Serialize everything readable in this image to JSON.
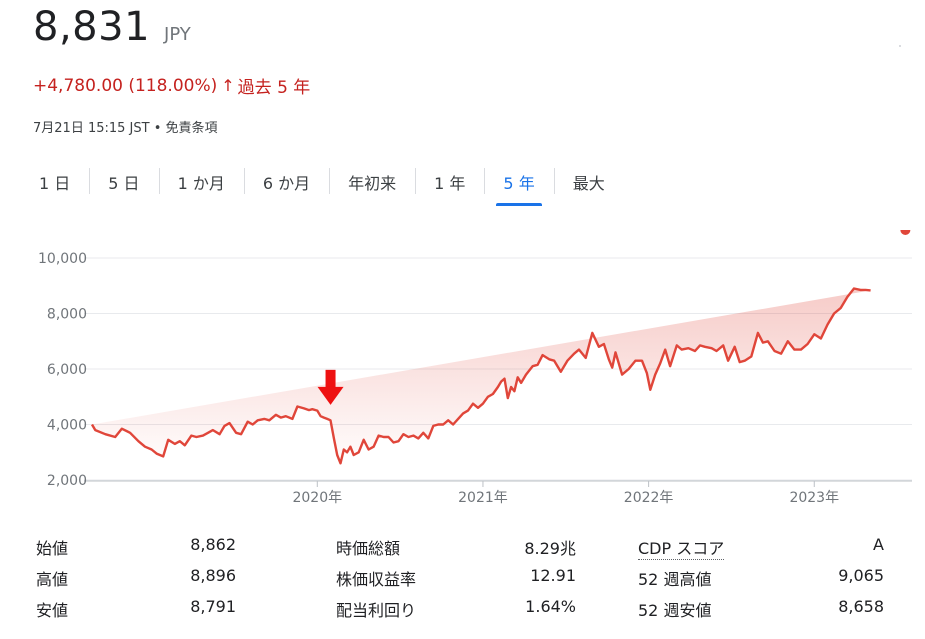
{
  "price": "8,831",
  "currency": "JPY",
  "change": "+4,780.00 (118.00%)",
  "change_arrow": "↑",
  "change_period": "過去 5 年",
  "timestamp": "7月21日 15:15 JST",
  "disclaimer": "免責条項",
  "tabs": [
    "1 日",
    "5 日",
    "1 か月",
    "6 か月",
    "年初来",
    "1 年",
    "5 年",
    "最大"
  ],
  "active_tab": "5 年",
  "colors": {
    "line": "#e0463a",
    "accent": "#1a73e8",
    "negative": "#c5221f",
    "marker": "#ee1111"
  },
  "chart_data": {
    "type": "area",
    "yticks": [
      "10,000",
      "8,000",
      "6,000",
      "4,000",
      "2,000"
    ],
    "ylim": [
      2000,
      10000
    ],
    "xticks": [
      {
        "label": "2020年",
        "t": 2020.0
      },
      {
        "label": "2021年",
        "t": 2021.0
      },
      {
        "label": "2022年",
        "t": 2022.0
      },
      {
        "label": "2023年",
        "t": 2023.0
      }
    ],
    "xlim": [
      2018.64,
      2023.59
    ],
    "annotation": {
      "type": "down-arrow",
      "t": 2020.08,
      "y": 4600
    },
    "series": [
      {
        "t": [
          2018.64,
          2018.66,
          2018.72,
          2018.78,
          2018.82,
          2018.87,
          2018.92,
          2018.96,
          2019.0,
          2019.03,
          2019.07,
          2019.1,
          2019.14,
          2019.17,
          2019.2,
          2019.24,
          2019.27,
          2019.31,
          2019.34,
          2019.37,
          2019.41,
          2019.44,
          2019.47,
          2019.51,
          2019.54,
          2019.58,
          2019.61,
          2019.64,
          2019.68,
          2019.71,
          2019.75,
          2019.78,
          2019.81,
          2019.85,
          2019.88,
          2019.92,
          2019.95,
          2019.97,
          2020.0,
          2020.02,
          2020.04,
          2020.06,
          2020.08,
          2020.1,
          2020.12,
          2020.14,
          2020.16,
          2020.18,
          2020.2,
          2020.22,
          2020.25,
          2020.28,
          2020.31,
          2020.34,
          2020.37,
          2020.4,
          2020.43,
          2020.46,
          2020.49,
          2020.52,
          2020.55,
          2020.58,
          2020.61,
          2020.64,
          2020.67,
          2020.7,
          2020.73,
          2020.76,
          2020.79,
          2020.82,
          2020.85,
          2020.88,
          2020.91,
          2020.94,
          2020.97,
          2021.0,
          2021.03,
          2021.06,
          2021.09,
          2021.11,
          2021.13,
          2021.15,
          2021.17,
          2021.19,
          2021.21,
          2021.23,
          2021.26,
          2021.3,
          2021.33,
          2021.36,
          2021.4,
          2021.43,
          2021.47,
          2021.51,
          2021.55,
          2021.58,
          2021.62,
          2021.66,
          2021.7,
          2021.73,
          2021.76,
          2021.78,
          2021.8,
          2021.84,
          2021.88,
          2021.92,
          2021.96,
          2021.99,
          2022.01,
          2022.04,
          2022.07,
          2022.1,
          2022.13,
          2022.17,
          2022.2,
          2022.24,
          2022.28,
          2022.31,
          2022.34,
          2022.38,
          2022.41,
          2022.45,
          2022.48,
          2022.52,
          2022.55,
          2022.58,
          2022.62,
          2022.66,
          2022.69,
          2022.72,
          2022.76,
          2022.8,
          2022.84,
          2022.88,
          2022.92,
          2022.96,
          2023.0,
          2023.04,
          2023.08,
          2023.12,
          2023.16,
          2023.2,
          2023.24,
          2023.28,
          2023.31,
          2023.34,
          2023.37,
          2023.4,
          2023.43,
          2023.46,
          2023.49,
          2023.52,
          2023.55
        ],
        "y": [
          4000,
          3800,
          3650,
          3550,
          3850,
          3700,
          3400,
          3200,
          3100,
          2950,
          2850,
          3450,
          3300,
          3400,
          3250,
          3600,
          3550,
          3600,
          3700,
          3800,
          3650,
          3950,
          4050,
          3700,
          3650,
          4100,
          4000,
          4150,
          4200,
          4150,
          4350,
          4250,
          4300,
          4200,
          4650,
          4580,
          4520,
          4550,
          4500,
          4300,
          4250,
          4200,
          4150,
          3500,
          2900,
          2600,
          3100,
          3000,
          3200,
          2900,
          3000,
          3450,
          3100,
          3200,
          3600,
          3550,
          3550,
          3350,
          3400,
          3650,
          3550,
          3600,
          3500,
          3700,
          3500,
          3950,
          4000,
          4000,
          4150,
          4000,
          4200,
          4400,
          4500,
          4750,
          4600,
          4750,
          5000,
          5100,
          5350,
          5550,
          5650,
          4950,
          5350,
          5200,
          5700,
          5500,
          5800,
          6100,
          6150,
          6500,
          6350,
          6300,
          5900,
          6300,
          6550,
          6700,
          6400,
          7300,
          6800,
          6900,
          6350,
          6050,
          6600,
          5800,
          6000,
          6300,
          6300,
          5850,
          5250,
          5800,
          6200,
          6700,
          6100,
          6850,
          6700,
          6750,
          6650,
          6850,
          6800,
          6750,
          6650,
          6850,
          6300,
          6800,
          6250,
          6300,
          6450,
          7300,
          6950,
          7000,
          6650,
          6550,
          7000,
          6700,
          6700,
          6900,
          7250,
          7100,
          7600,
          8000,
          8200,
          8600,
          8900,
          8850,
          8850,
          8831
        ]
      }
    ]
  },
  "stats": [
    [
      {
        "label": "始値",
        "value": "8,862"
      },
      {
        "label": "時価総額",
        "value": "8.29兆"
      },
      {
        "label": "CDP スコア",
        "value": "A"
      }
    ],
    [
      {
        "label": "高値",
        "value": "8,896"
      },
      {
        "label": "株価収益率",
        "value": "12.91"
      },
      {
        "label": "52 週高値",
        "value": "9,065"
      }
    ],
    [
      {
        "label": "安値",
        "value": "8,791"
      },
      {
        "label": "配当利回り",
        "value": "1.64%"
      },
      {
        "label": "52 週安値",
        "value": "8,658"
      }
    ]
  ]
}
